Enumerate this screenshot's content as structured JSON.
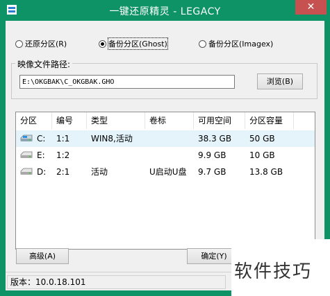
{
  "window": {
    "title": "一键还原精灵 - LEGACY",
    "close_glyph": "✕"
  },
  "mode_options": [
    {
      "label": "还原分区(R)",
      "selected": false
    },
    {
      "label": "备份分区(Ghost)",
      "selected": true
    },
    {
      "label": "备份分区(Imagex)",
      "selected": false
    }
  ],
  "image_path": {
    "group_title": "映像文件路径:",
    "value": "E:\\OKGBAK\\C_OKGBAK.GHO",
    "browse_label": "浏览(B)"
  },
  "partition_table": {
    "headers": [
      "分区",
      "编号",
      "类型",
      "卷标",
      "可用空间",
      "分区容量"
    ],
    "rows": [
      {
        "drive": "C:",
        "number": "1:1",
        "type": "WIN8,活动",
        "label": "",
        "free": "38.3 GB",
        "size": "50 GB",
        "icon": "system-drive-icon"
      },
      {
        "drive": "E:",
        "number": "1:2",
        "type": "",
        "label": "",
        "free": "9.9 GB",
        "size": "10 GB",
        "icon": "drive-icon"
      },
      {
        "drive": "D:",
        "number": "2:1",
        "type": "活动",
        "label": "U启动U盘",
        "free": "9.7 GB",
        "size": "13.8 GB",
        "icon": "drive-icon"
      }
    ]
  },
  "buttons": {
    "advanced": "高级(A)",
    "ok": "确定(Y)"
  },
  "status": {
    "version": "版本：10.0.18.101"
  },
  "watermark": {
    "text": "软件技巧"
  },
  "colors": {
    "titlebar": "#0e9367",
    "close": "#c75050",
    "selected_row": "#e5f3fb"
  }
}
